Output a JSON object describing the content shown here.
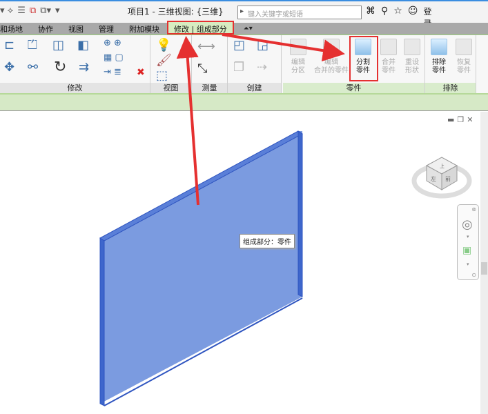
{
  "title": "项目1 - 三维视图: {三维}",
  "search": {
    "placeholder": "键入关键字或短语"
  },
  "account": {
    "login": "登录"
  },
  "tabs": [
    "和场地",
    "协作",
    "视图",
    "管理",
    "附加模块",
    "修改 | 组成部分"
  ],
  "active_tab": "修改 | 组成部分",
  "panels": {
    "modify": "修改",
    "view": "视图",
    "measure": "测量",
    "create": "创建",
    "parts": "零件",
    "exclude": "排除"
  },
  "buttons": {
    "edit_division": [
      "编辑",
      "分区"
    ],
    "edit_merged": [
      "编辑",
      "合并的零件"
    ],
    "divide_parts": [
      "分割",
      "零件"
    ],
    "merge_parts": [
      "合并",
      "零件"
    ],
    "reset_shape": [
      "重设",
      "形状"
    ],
    "exclude_parts": [
      "排除",
      "零件"
    ],
    "restore_parts": [
      "恢复",
      "零件"
    ]
  },
  "tooltip": "组成部分：零件",
  "viewcube": {
    "top": "上",
    "left": "左",
    "front": "前"
  },
  "colors": {
    "accent_red": "#e53030",
    "plate": "#7b9be0",
    "plate_edge": "#3a5fc8",
    "ribbon_green": "#d6e9c6"
  }
}
